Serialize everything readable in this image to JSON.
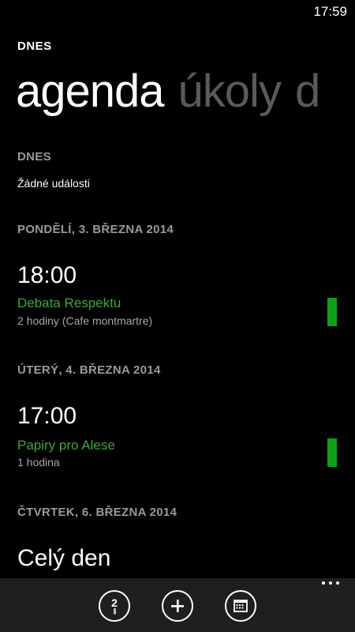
{
  "status": {
    "time": "17:59"
  },
  "app": {
    "title": "DNES"
  },
  "pivot": {
    "tabs": [
      "agenda",
      "úkoly",
      "d"
    ]
  },
  "sections": [
    {
      "header": "DNES",
      "empty_text": "Žádné události"
    },
    {
      "header": "PONDĚLÍ, 3. BŘEZNA 2014",
      "event": {
        "time": "18:00",
        "title": "Debata Respektu",
        "detail": "2 hodiny (Cafe montmartre)",
        "color": "#0f9f1a"
      }
    },
    {
      "header": "ÚTERÝ, 4. BŘEZNA 2014",
      "event": {
        "time": "17:00",
        "title": "Papiry pro Alese",
        "detail": "1 hodina",
        "color": "#0f9f1a"
      }
    },
    {
      "header": "ČTVRTEK, 6. BŘEZNA 2014",
      "allday": "Celý den"
    }
  ],
  "appbar": {
    "today_number": "2",
    "today_icon": "today-icon",
    "add_icon": "plus-icon",
    "calendar_icon": "calendar-icon",
    "more_icon": "ellipsis-icon"
  }
}
